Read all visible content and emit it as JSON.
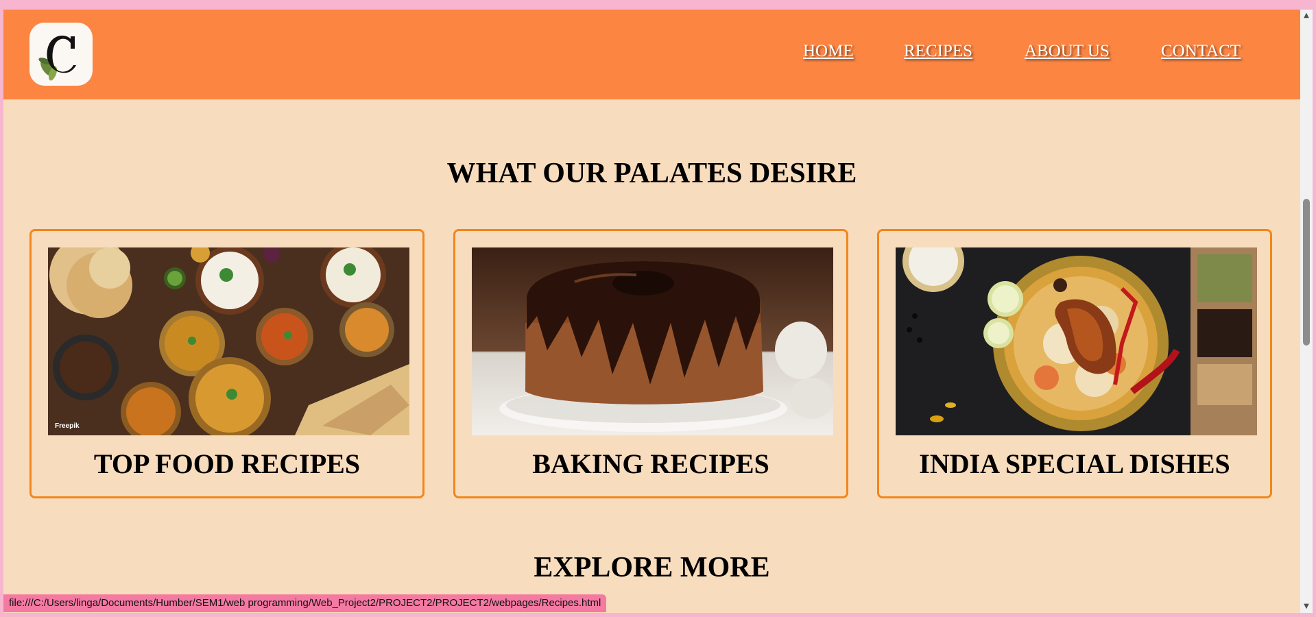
{
  "nav": {
    "home": "HOME",
    "recipes": "RECIPES",
    "about": "ABOUT US",
    "contact": "CONTACT"
  },
  "main": {
    "section_title": "WHAT OUR PALATES DESIRE",
    "cards": [
      {
        "title": "TOP FOOD RECIPES",
        "watermark": "Freepik"
      },
      {
        "title": "BAKING RECIPES"
      },
      {
        "title": "INDIA SPECIAL DISHES"
      }
    ],
    "explore_title": "EXPLORE MORE"
  },
  "status_bar": {
    "url": "file:///C:/Users/linga/Documents/Humber/SEM1/web programming/Web_Project2/PROJECT2/PROJECT2/webpages/Recipes.html"
  },
  "colors": {
    "navbar": "#fc8542",
    "page_background": "#f8dcbe",
    "card_border": "#f2861c",
    "frame": "#f8b5cf"
  },
  "icons": {
    "logo": "letter-c-leaf-logo",
    "scroll_up": "scroll-up-arrow-icon",
    "scroll_down": "scroll-down-arrow-icon"
  }
}
